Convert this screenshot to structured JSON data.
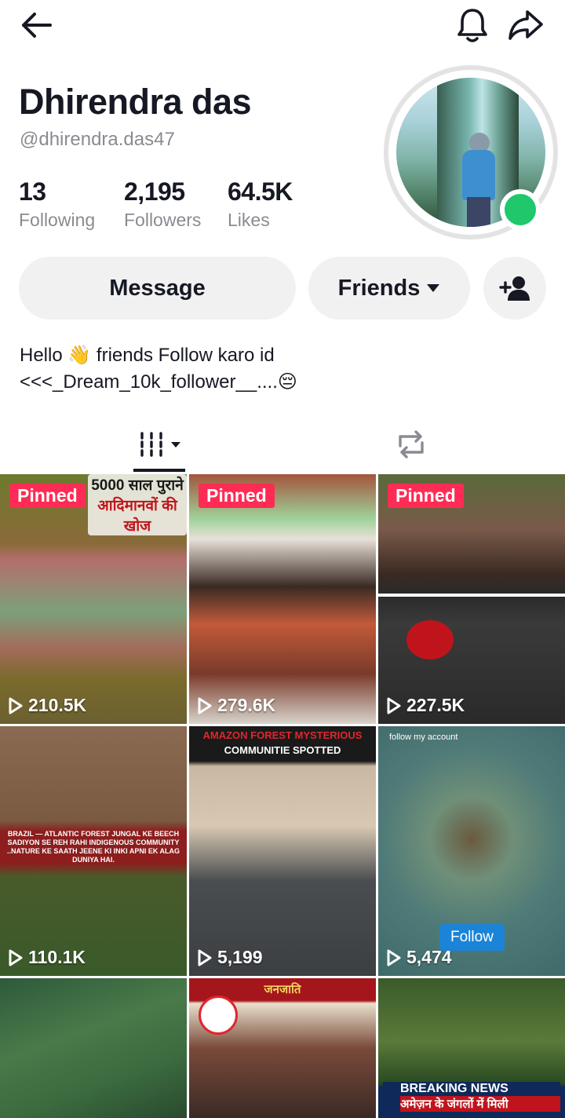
{
  "profile": {
    "name": "Dhirendra das",
    "handle": "@dhirendra.das47",
    "bio_line1": "Hello 👋 friends Follow karo id",
    "bio_line2": "<<<_Dream_10k_follower__....😔"
  },
  "stats": [
    {
      "value": "13",
      "label": "Following"
    },
    {
      "value": "2,195",
      "label": "Followers"
    },
    {
      "value": "64.5K",
      "label": "Likes"
    }
  ],
  "actions": {
    "message_label": "Message",
    "friends_label": "Friends"
  },
  "colors": {
    "accent": "#fe2c55",
    "online": "#1fc86b",
    "text": "#161823",
    "muted": "#8a8b91",
    "pill": "#f1f1f2"
  },
  "icons": {
    "back": "arrow-left-icon",
    "bell": "bell-icon",
    "share": "share-arrow-icon",
    "add_friend": "person-add-icon",
    "posts_tab": "grid-icon",
    "reposts_tab": "repost-icon",
    "play": "play-icon"
  },
  "videos": [
    {
      "pinned_label": "Pinned",
      "views": "210.5K",
      "caption_top": "5000 साल पुराने",
      "caption_bottom": "आदिमानवों की खोज"
    },
    {
      "pinned_label": "Pinned",
      "views": "279.6K"
    },
    {
      "pinned_label": "Pinned",
      "views": "227.5K"
    },
    {
      "views": "110.1K",
      "caption": "BRAZIL — ATLANTIC FOREST JUNGAL KE BEECH SADIYON SE REH RAHI INDIGENOUS COMMUNITY ..NATURE KE SAATH JEENE KI INKI APNI EK ALAG DUNIYA HAI."
    },
    {
      "views": "5,199",
      "caption_top": "AMAZON FOREST MYSTERIOUS",
      "caption_bottom": "COMMUNITIE SPOTTED"
    },
    {
      "views": "5,474",
      "note": "follow my account",
      "follow_label": "Follow"
    },
    {
      "caption_top": ""
    },
    {
      "caption_top": "जनजाति"
    },
    {
      "caption_top": "BREAKING NEWS",
      "caption_bottom": "अमेज़न के जंगलों में मिली"
    }
  ]
}
